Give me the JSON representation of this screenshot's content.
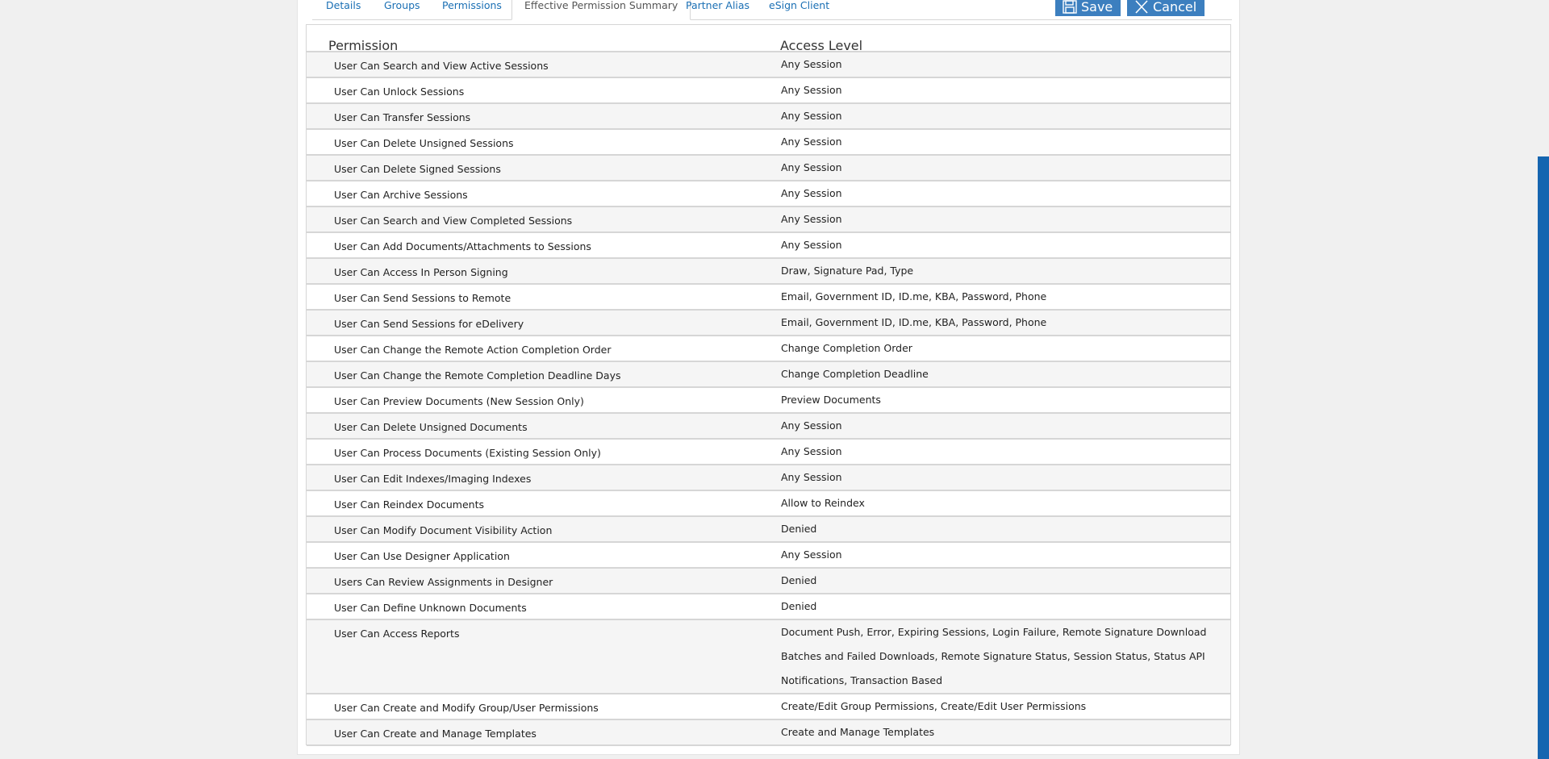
{
  "tabs": [
    {
      "label": "Details"
    },
    {
      "label": "Groups"
    },
    {
      "label": "Permissions"
    },
    {
      "label": "Effective Permission Summary",
      "active": true
    },
    {
      "label": "Partner Alias"
    },
    {
      "label": "eSign Client"
    }
  ],
  "actions": {
    "save_label": "Save",
    "cancel_label": "Cancel"
  },
  "table": {
    "columns": [
      "Permission",
      "Access Level"
    ],
    "rows": [
      {
        "permission": "User Can Search and View Active Sessions",
        "access": "Any Session"
      },
      {
        "permission": "User Can Unlock Sessions",
        "access": "Any Session"
      },
      {
        "permission": "User Can Transfer Sessions",
        "access": "Any Session"
      },
      {
        "permission": "User Can Delete Unsigned Sessions",
        "access": "Any Session"
      },
      {
        "permission": "User Can Delete Signed Sessions",
        "access": "Any Session"
      },
      {
        "permission": "User Can Archive Sessions",
        "access": "Any Session"
      },
      {
        "permission": "User Can Search and View Completed Sessions",
        "access": "Any Session"
      },
      {
        "permission": "User Can Add Documents/Attachments to Sessions",
        "access": "Any Session"
      },
      {
        "permission": "User Can Access In Person Signing",
        "access": "Draw, Signature Pad, Type"
      },
      {
        "permission": "User Can Send Sessions to Remote",
        "access": "Email, Government ID, ID.me, KBA, Password, Phone"
      },
      {
        "permission": "User Can Send Sessions for eDelivery",
        "access": "Email, Government ID, ID.me, KBA, Password, Phone"
      },
      {
        "permission": "User Can Change the Remote Action Completion Order",
        "access": "Change Completion Order"
      },
      {
        "permission": "User Can Change the Remote Completion Deadline Days",
        "access": "Change Completion Deadline"
      },
      {
        "permission": "User Can Preview Documents (New Session Only)",
        "access": "Preview Documents"
      },
      {
        "permission": "User Can Delete Unsigned Documents",
        "access": "Any Session"
      },
      {
        "permission": "User Can Process Documents (Existing Session Only)",
        "access": "Any Session"
      },
      {
        "permission": "User Can Edit Indexes/Imaging Indexes",
        "access": "Any Session"
      },
      {
        "permission": "User Can Reindex Documents",
        "access": "Allow to Reindex"
      },
      {
        "permission": "User Can Modify Document Visibility Action",
        "access": "Denied"
      },
      {
        "permission": "User Can Use Designer Application",
        "access": "Any Session"
      },
      {
        "permission": "Users Can Review Assignments in Designer",
        "access": "Denied"
      },
      {
        "permission": "User Can Define Unknown Documents",
        "access": "Denied"
      },
      {
        "permission": "User Can Access Reports",
        "access": "Document Push, Error, Expiring Sessions, Login Failure, Remote Signature Download Batches and Failed Downloads, Remote Signature Status, Session Status, Status API Notifications, Transaction Based"
      },
      {
        "permission": "User Can Create and Modify Group/User Permissions",
        "access": "Create/Edit Group Permissions, Create/Edit User Permissions"
      },
      {
        "permission": "User Can Create and Manage Templates",
        "access": "Create and Manage Templates"
      }
    ]
  },
  "colors": {
    "accent": "#1a6fb4",
    "button": "#3c7fbf",
    "scrollbar": "#1565b0"
  },
  "icons": {
    "save": "floppy-disk-icon",
    "cancel": "close-x-icon"
  }
}
